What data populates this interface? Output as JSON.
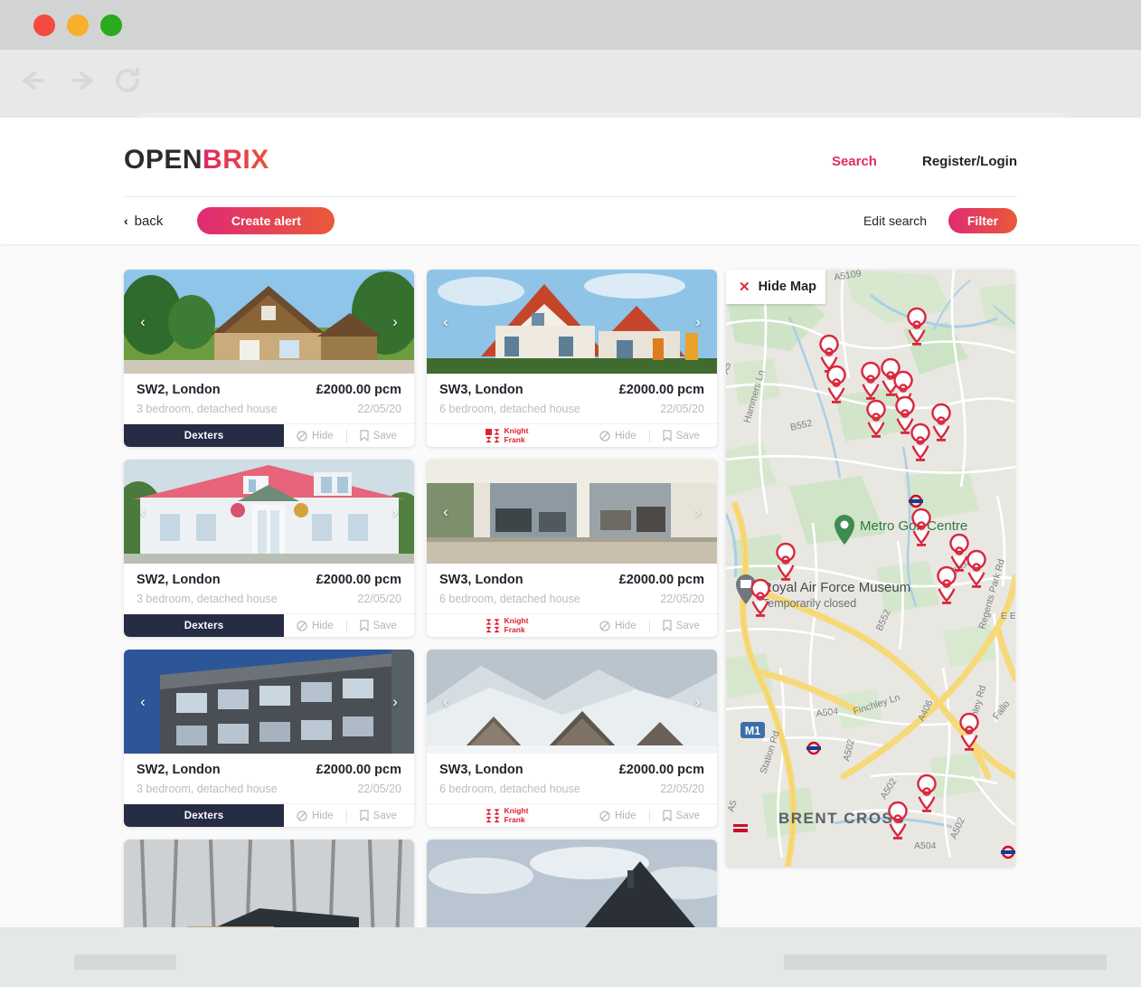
{
  "browser": {
    "window_controls": [
      "close",
      "minimize",
      "maximize"
    ],
    "nav": {
      "back": "back-arrow",
      "forward": "forward-arrow",
      "reload": "reload-arrow"
    },
    "url_value": "",
    "url_placeholder": "",
    "search_icon": "search-icon"
  },
  "site": {
    "logo": {
      "part1": "OPEN",
      "part2": "BRIX"
    },
    "nav": {
      "search": "Search",
      "register_login": "Register/Login"
    },
    "subbar": {
      "back": "back",
      "back_chevron": "‹",
      "create_alert": "Create alert",
      "edit_search": "Edit search",
      "filter": "Filter"
    },
    "accent_gradient_from": "#e02a74",
    "accent_gradient_to": "#ea5a38",
    "accent_pink": "#e32b5e",
    "agency_navy": "#262c44",
    "knight_red": "#e1202e"
  },
  "cards": [
    {
      "title": "SW2, London",
      "price": "£2000.00 pcm",
      "subtitle": "3 bedroom, detached house",
      "date": "22/05/20",
      "agency": "Dexters",
      "agency_type": "dexters",
      "hide": "Hide",
      "save": "Save",
      "prev": "‹",
      "next": "›",
      "photo": "cottage-wooden-house-green-lawn"
    },
    {
      "title": "SW3, London",
      "price": "£2000.00 pcm",
      "subtitle": "6 bedroom, detached house",
      "date": "22/05/20",
      "agency_line1": "Knight",
      "agency_line2": "Frank",
      "agency_type": "knight",
      "hide": "Hide",
      "save": "Save",
      "prev": "‹",
      "next": "›",
      "photo": "tudor-house-orange-roof-blue-sky"
    },
    {
      "title": "SW2, London",
      "price": "£2000.00 pcm",
      "subtitle": "3 bedroom, detached house",
      "date": "22/05/20",
      "agency": "Dexters",
      "agency_type": "dexters",
      "hide": "Hide",
      "save": "Save",
      "prev": "‹",
      "next": "›",
      "photo": "white-house-red-roof"
    },
    {
      "title": "SW3, London",
      "price": "£2000.00 pcm",
      "subtitle": "6 bedroom, detached house",
      "date": "22/05/20",
      "agency_line1": "Knight",
      "agency_line2": "Frank",
      "agency_type": "knight",
      "hide": "Hide",
      "save": "Save",
      "prev": "‹",
      "next": "›",
      "photo": "modern-glass-living-room-interior"
    },
    {
      "title": "SW2, London",
      "price": "£2000.00 pcm",
      "subtitle": "3 bedroom, detached house",
      "date": "22/05/20",
      "agency": "Dexters",
      "agency_type": "dexters",
      "hide": "Hide",
      "save": "Save",
      "prev": "‹",
      "next": "›",
      "photo": "modern-dark-apartment-block-blue-sky"
    },
    {
      "title": "SW3, London",
      "price": "£2000.00 pcm",
      "subtitle": "6 bedroom, detached house",
      "date": "22/05/20",
      "agency_line1": "Knight",
      "agency_line2": "Frank",
      "agency_type": "knight",
      "hide": "Hide",
      "save": "Save",
      "prev": "‹",
      "next": "›",
      "photo": "snowy-mountain-cabins"
    },
    {
      "photo": "stone-cabin-in-winter-forest",
      "partial": true
    },
    {
      "photo": "dark-gabled-roof-against-clouds",
      "partial": true
    }
  ],
  "map": {
    "hide_map_label": "Hide Map",
    "close_icon": "✕",
    "pin_color": "#d9273e",
    "places": [
      {
        "name": "Metro Golf Centre",
        "type": "golf",
        "color": "#2f7a3e"
      },
      {
        "name": "Royal Air Force Museum",
        "status": "Temporarily closed",
        "type": "museum",
        "color": "#5c6166"
      },
      {
        "name": "BRENT CROSS",
        "type": "district"
      }
    ],
    "roads": [
      "A5109",
      "A5",
      "B552",
      "B552",
      "A504",
      "A502",
      "A502",
      "A504",
      "A406",
      "A406",
      "A502",
      "M1",
      "Hammers Ln",
      "Station Rd",
      "Finchley Ln",
      "Finchley Rd",
      "Regents Park Rd",
      "E End",
      "Falloden"
    ],
    "motorway_badge": "M1",
    "pin_count": 22
  },
  "bottom_bar": {
    "left_block": "",
    "right_block": ""
  }
}
